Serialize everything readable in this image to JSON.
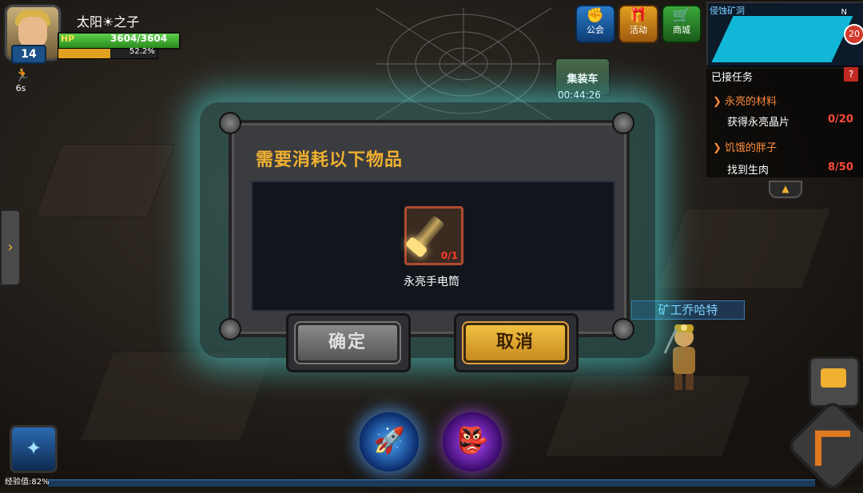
{
  "player": {
    "name": "太阳☀之子",
    "level": "14",
    "hp_label": "HP",
    "hp_value": "3604/3604",
    "hp_fraction": 1.0,
    "exp_percent_label": "52.2%",
    "exp_fraction": 0.522,
    "buff_timer": "6s"
  },
  "top_buttons": [
    {
      "label": "公会",
      "icon": "guild-fist-icon"
    },
    {
      "label": "活动",
      "icon": "event-gift-icon"
    },
    {
      "label": "商城",
      "icon": "shop-cart-icon"
    }
  ],
  "truck": {
    "label": "集装车",
    "timer": "00:44:26"
  },
  "minimap": {
    "title": "侵蚀矿洞",
    "badge": "20",
    "north": "N"
  },
  "quests": {
    "header": "已接任务",
    "help": "?",
    "items": [
      {
        "title": "永亮的材料",
        "task": "获得永亮晶片",
        "progress": "0/20"
      },
      {
        "title": "饥饿的胖子",
        "task": "找到生肉",
        "progress": "8/50"
      }
    ]
  },
  "dialog": {
    "title": "需要消耗以下物品",
    "item_name": "永亮手电筒",
    "item_count": "0/1",
    "confirm_label": "确定",
    "cancel_label": "取消"
  },
  "npc": {
    "name": "矿工乔哈特"
  },
  "footer": {
    "exp_label": "经验值:82%"
  },
  "colors": {
    "accent_gold": "#f0b030",
    "glow_cyan": "#50e6e6",
    "quest_red": "#ff4a3a"
  }
}
